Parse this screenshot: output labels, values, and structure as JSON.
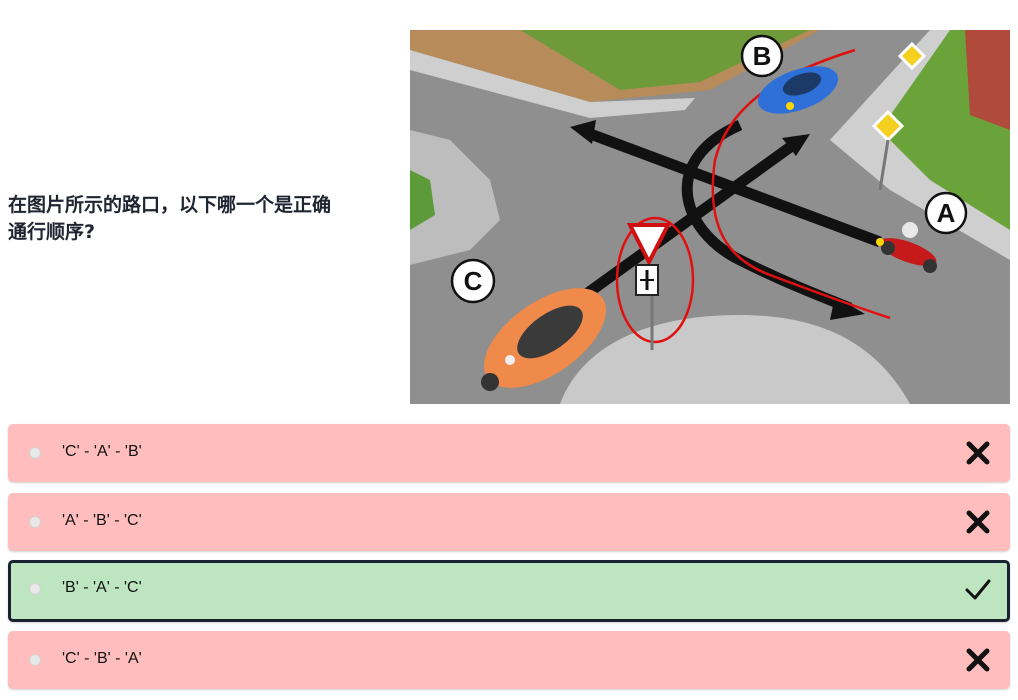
{
  "question": {
    "text_line1": "在图片所示的路口，以下哪一个是正确",
    "text_line2": "通行顺序?"
  },
  "scene": {
    "labels": {
      "a": "A",
      "b": "B",
      "c": "C"
    },
    "description_icons": [
      "yield-sign-icon",
      "priority-road-sign-icon",
      "motorcycle-icon",
      "car-icon"
    ]
  },
  "options": [
    {
      "label": "'C' - 'A' - 'B'",
      "status": "wrong",
      "icon": "cross-icon"
    },
    {
      "label": "'A' - 'B' - 'C'",
      "status": "wrong",
      "icon": "cross-icon"
    },
    {
      "label": "'B' - 'A' - 'C'",
      "status": "correct",
      "icon": "check-icon"
    },
    {
      "label": "'C' - 'B' - 'A'",
      "status": "wrong",
      "icon": "cross-icon"
    }
  ],
  "colors": {
    "wrong_bg": "#ffbdbd",
    "correct_bg": "#bde6c0",
    "correct_border": "#182230",
    "annotation": "#e01010"
  }
}
